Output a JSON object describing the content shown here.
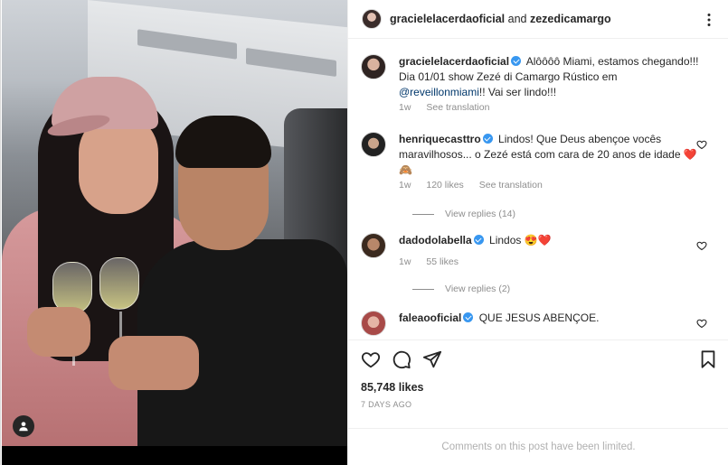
{
  "post": {
    "author": "gracielelacerdaoficial",
    "and_word": "and",
    "coauthor": "zezedicamargo",
    "likes": "85,748 likes",
    "age": "7 DAYS AGO",
    "comments_limited": "Comments on this post have been limited."
  },
  "caption": {
    "user": "gracielelacerdaoficial",
    "text_before": "Alôôôô Miami, estamos chegando!!! Dia 01/01 show Zezé di Camargo Rústico em ",
    "mention": "@reveillonmiami",
    "text_after": "!! Vai ser lindo!!!",
    "age": "1w",
    "see_translation": "See translation"
  },
  "comments": [
    {
      "user": "henriquecasttro",
      "text": "Lindos! Que Deus abençoe vocês maravilhosos... o Zezé está com cara de 20 anos de idade ❤️🙈",
      "age": "1w",
      "likes": "120 likes",
      "see_translation": "See translation",
      "view_replies": "View replies (14)"
    },
    {
      "user": "dadodolabella",
      "text": "Lindos 😍❤️",
      "age": "1w",
      "likes": "55 likes",
      "view_replies": "View replies (2)"
    },
    {
      "user": "faleaooficial",
      "text": "QUE JESUS ABENÇOE."
    }
  ],
  "icons": {
    "more": "more-options-icon",
    "like": "heart-icon",
    "comment": "comment-icon",
    "share": "paper-plane-icon",
    "save": "bookmark-icon",
    "user_tag": "user-tag-icon"
  },
  "colors": {
    "verified": "#3897f0",
    "mention": "#00376b",
    "muted": "#8e8e8e"
  }
}
